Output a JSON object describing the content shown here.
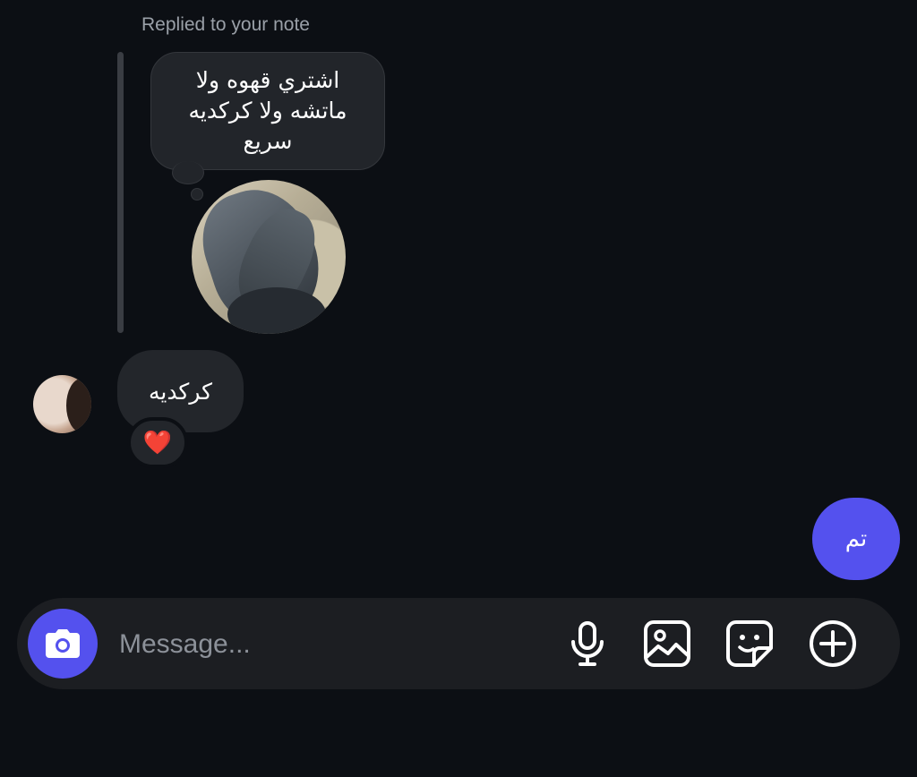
{
  "reply_context": {
    "caption": "Replied to your note",
    "note_text": "اشتري قهوه ولا ماتشه ولا كركديه سريع"
  },
  "received_message": {
    "text": "كركديه",
    "reaction": "❤️"
  },
  "sent_message": {
    "text": "تم"
  },
  "composer": {
    "placeholder": "Message...",
    "icons": [
      "camera-icon",
      "microphone-icon",
      "gallery-icon",
      "sticker-icon",
      "add-icon"
    ]
  },
  "colors": {
    "background": "#0c0f14",
    "bubble": "#23262b",
    "accent": "#5451ee",
    "heart": "#e0213b"
  }
}
